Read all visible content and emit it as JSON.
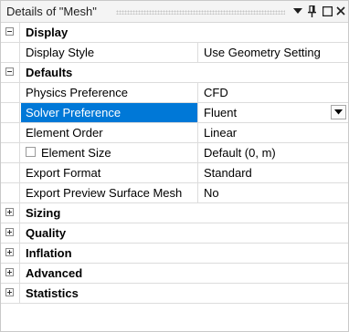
{
  "panel": {
    "title": "Details of \"Mesh\"",
    "icons": [
      "dropdown-arrow-icon",
      "pin-icon",
      "maximize-icon",
      "close-icon"
    ]
  },
  "groups": {
    "display": {
      "label": "Display",
      "expanded": true
    },
    "defaults": {
      "label": "Defaults",
      "expanded": true
    },
    "sizing": {
      "label": "Sizing",
      "expanded": false
    },
    "quality": {
      "label": "Quality",
      "expanded": false
    },
    "inflation": {
      "label": "Inflation",
      "expanded": false
    },
    "advanced": {
      "label": "Advanced",
      "expanded": false
    },
    "statistics": {
      "label": "Statistics",
      "expanded": false
    }
  },
  "properties": {
    "display_style": {
      "name": "Display Style",
      "value": "Use Geometry Setting"
    },
    "physics_preference": {
      "name": "Physics Preference",
      "value": "CFD"
    },
    "solver_preference": {
      "name": "Solver Preference",
      "value": "Fluent",
      "selected": true
    },
    "element_order": {
      "name": "Element Order",
      "value": "Linear"
    },
    "element_size": {
      "name": "Element Size",
      "value": "Default (0, m)",
      "checked": false
    },
    "export_format": {
      "name": "Export Format",
      "value": "Standard"
    },
    "export_preview": {
      "name": "Export Preview Surface Mesh",
      "value": "No"
    }
  },
  "colors": {
    "selection": "#0078d7",
    "gridline": "#dcdcdc",
    "titlebar": "#f4f4f4"
  }
}
